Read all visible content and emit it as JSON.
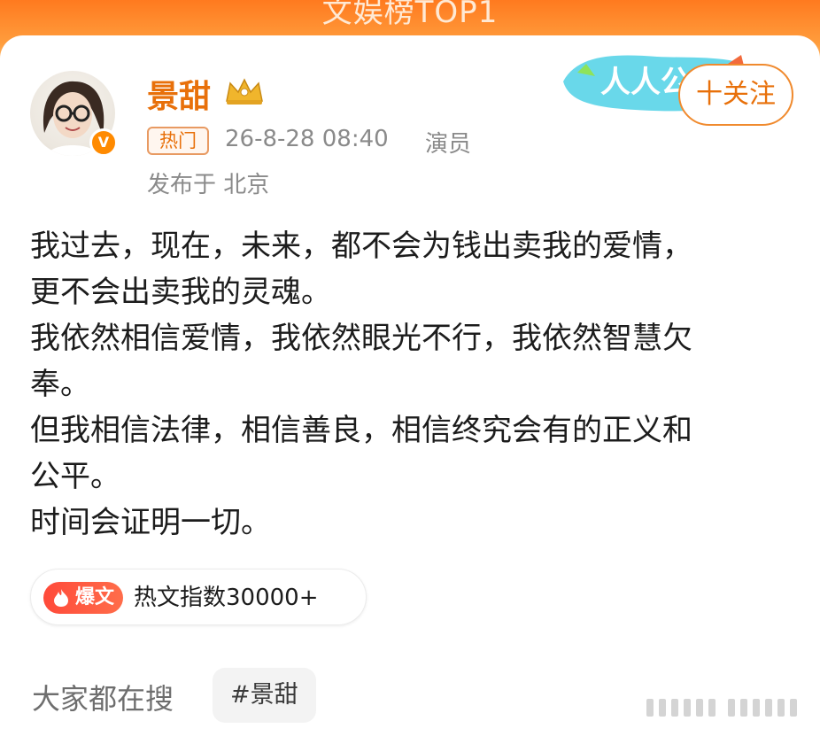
{
  "banner": {
    "title": "文娱榜TOP1"
  },
  "user": {
    "name": "景甜",
    "verified_mark": "V",
    "hot_tag": "热门",
    "timestamp": "26-8-28 08:40",
    "role": "演员",
    "location": "发布于 北京"
  },
  "header": {
    "badge_text": "人人公",
    "follow_label": "十关注"
  },
  "post": {
    "lines": [
      "我过去，现在，未来，都不会为钱出卖我的爱情，",
      "更不会出卖我的灵魂。",
      "我依然相信爱情，我依然眼光不行，我依然智慧欠",
      "奉。",
      "但我相信法律，相信善良，相信终究会有的正义和",
      "公平。",
      "时间会证明一切。"
    ]
  },
  "hot_index": {
    "badge": "爆文",
    "text": "热文指数30000+"
  },
  "search": {
    "label": "大家都在搜",
    "tag": "#景甜"
  },
  "colors": {
    "accent": "#e8700a",
    "banner": "#ff7a1f",
    "hot_badge": "#ff4a3a"
  },
  "icons": [
    "crown-icon",
    "verified-icon",
    "flame-icon",
    "watermark-icon"
  ]
}
